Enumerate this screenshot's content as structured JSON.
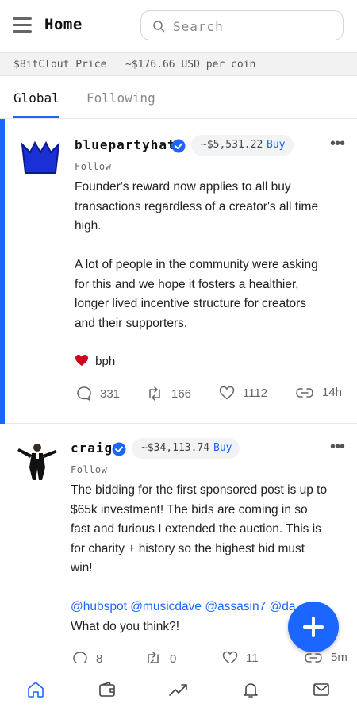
{
  "header": {
    "title": "Home",
    "search_placeholder": "Search"
  },
  "price_bar": {
    "label": "$BitClout Price",
    "value": "~$176.66 USD per coin"
  },
  "tabs": [
    {
      "label": "Global",
      "active": true
    },
    {
      "label": "Following",
      "active": false
    }
  ],
  "posts": [
    {
      "username": "bluepartyhat",
      "verified": true,
      "coin_price": "~$5,531.22",
      "buy_label": "Buy",
      "follow_label": "Follow",
      "paragraphs": [
        [
          "Founder's reward now applies to all buy",
          "transactions regardless of a creator's all time",
          "high."
        ],
        [
          "A lot of people in the community were asking",
          "for this and we hope it fosters a healthier,",
          "longer lived incentive structure for creators",
          "and their supporters."
        ]
      ],
      "reaction_name": "bph",
      "comments": "331",
      "reclouts": "166",
      "likes": "1112",
      "age": "14h"
    },
    {
      "username": "craig",
      "verified": true,
      "coin_price": "~$34,113.74",
      "buy_label": "Buy",
      "follow_label": "Follow",
      "lines": [
        "The bidding for the first sponsored post is up to",
        "$65k investment! The bids are coming in so",
        "fast and furious I extended the auction. This is",
        "for charity + history so the highest bid must",
        "win!"
      ],
      "mentions": "@hubspot @musicdave @assasin7 @da…s",
      "question": "What do you think?!",
      "comments": "8",
      "reclouts": "0",
      "likes": "11",
      "age": "5m"
    }
  ],
  "colors": {
    "accent": "#1b66ff",
    "heart": "#d0021b",
    "avatar_crown": "#1a2fd6"
  },
  "bottom_nav": [
    "home-icon",
    "wallet-icon",
    "trending-icon",
    "bell-icon",
    "mail-icon"
  ]
}
